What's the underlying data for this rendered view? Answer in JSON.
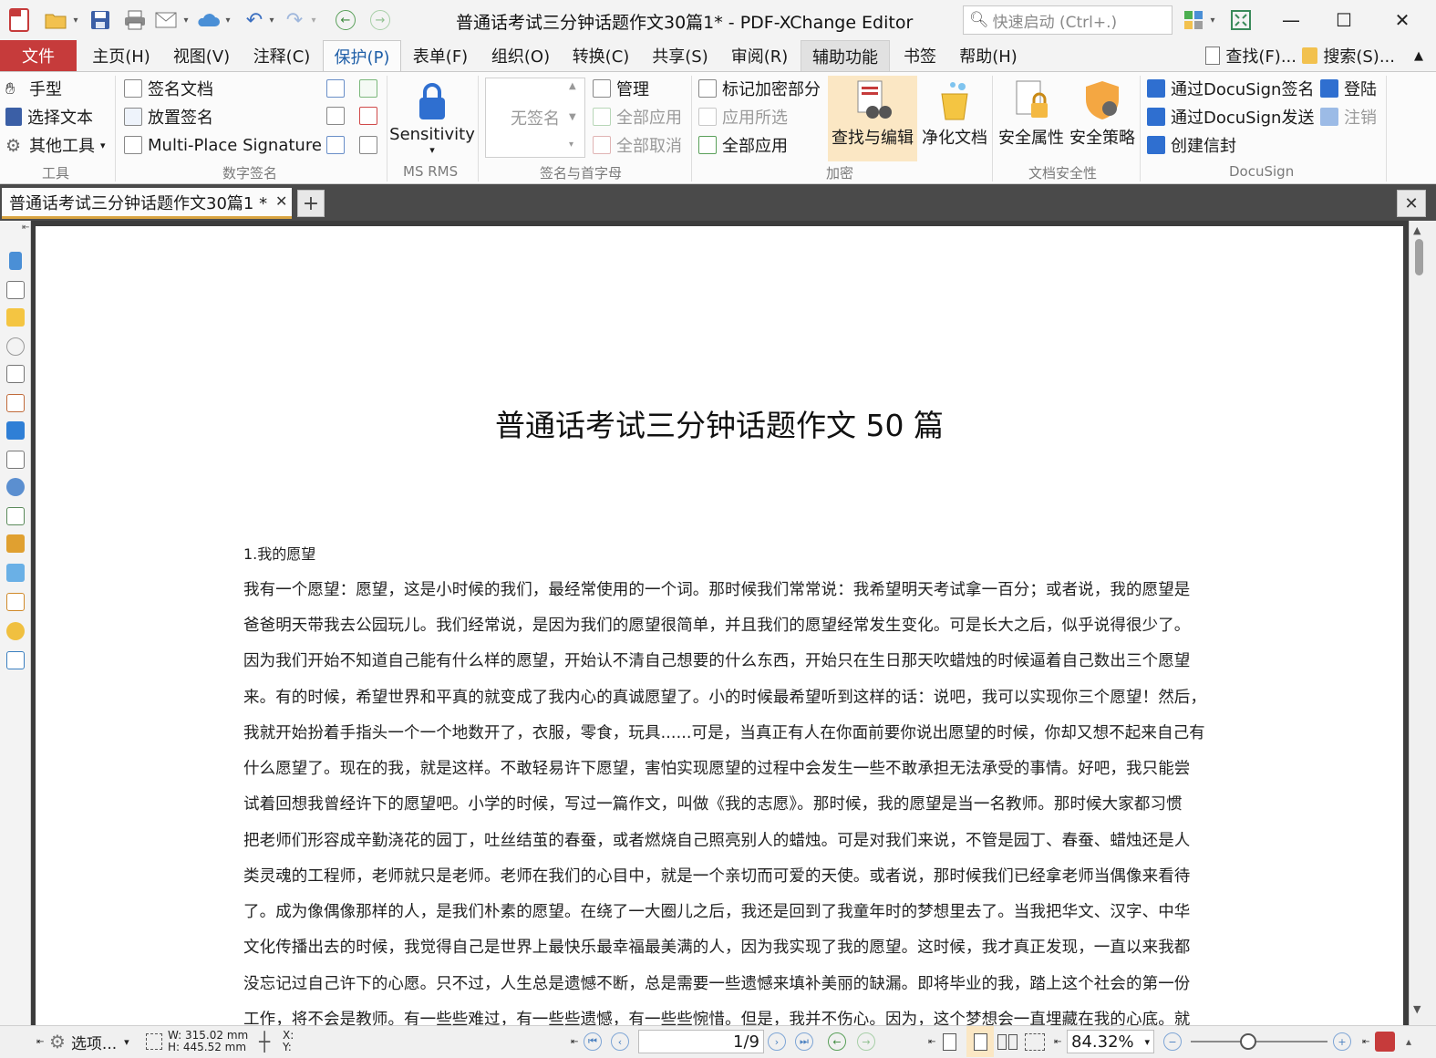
{
  "window": {
    "title": "普通话考试三分钟话题作文30篇1* - PDF-XChange Editor",
    "quick_launch_placeholder": "快速启动 (Ctrl+.)"
  },
  "menu": {
    "tabs": [
      "文件",
      "主页(H)",
      "视图(V)",
      "注释(C)",
      "保护(P)",
      "表单(F)",
      "组织(O)",
      "转换(C)",
      "共享(S)",
      "审阅(R)",
      "辅助功能",
      "书签",
      "帮助(H)"
    ],
    "active_tab": "保护(P)",
    "find_label": "查找(F)...",
    "search_label": "搜索(S)..."
  },
  "ribbon": {
    "tools": {
      "hand": "手型",
      "select_text": "选择文本",
      "other_tools": "其他工具",
      "group": "工具"
    },
    "digital_sign": {
      "sign_doc": "签名文档",
      "place_sig": "放置签名",
      "multi_place": "Multi-Place Signature",
      "group": "数字签名"
    },
    "ms_rms": {
      "sensitivity": "Sensitivity",
      "group": "MS RMS"
    },
    "sig_initials": {
      "no_signature": "无签名",
      "manage": "管理",
      "apply_all": "全部应用",
      "cancel_all": "全部取消",
      "group": "签名与首字母"
    },
    "redact": {
      "mark_redact": "标记加密部分",
      "apply_selected": "应用所选",
      "apply_all": "全部应用",
      "find_edit": "查找与编辑",
      "sanitize": "净化文档",
      "group": "加密"
    },
    "doc_security": {
      "sec_props": "安全属性",
      "sec_policy": "安全策略",
      "group": "文档安全性"
    },
    "docusign": {
      "sign_via": "通过DocuSign签名",
      "send_via": "通过DocuSign发送",
      "create_env": "创建信封",
      "login": "登陆",
      "logout": "注销",
      "group": "DocuSign"
    }
  },
  "doc_tab": {
    "name": "普通话考试三分钟话题作文30篇1 *"
  },
  "document": {
    "title": "普通话考试三分钟话题作文 50 篇",
    "section_heading": "1.我的愿望",
    "lines": [
      "我有一个愿望：愿望，这是小时候的我们，最经常使用的一个词。那时候我们常常说：我希望明天考试拿一百分；或者说，我的愿望是",
      "爸爸明天带我去公园玩儿。我们经常说，是因为我们的愿望很简单，并且我们的愿望经常发生变化。可是长大之后，似乎说得很少了。",
      "因为我们开始不知道自己能有什么样的愿望，开始认不清自己想要的什么东西，开始只在生日那天吹蜡烛的时候逼着自己数出三个愿望",
      "来。有的时候，希望世界和平真的就变成了我内心的真诚愿望了。小的时候最希望听到这样的话：说吧，我可以实现你三个愿望！然后，",
      "我就开始扮着手指头一个一个地数开了，衣服，零食，玩具......可是，当真正有人在你面前要你说出愿望的时候，你却又想不起来自己有",
      "什么愿望了。现在的我，就是这样。不敢轻易许下愿望，害怕实现愿望的过程中会发生一些不敢承担无法承受的事情。好吧，我只能尝",
      "试着回想我曾经许下的愿望吧。小学的时候，写过一篇作文，叫做《我的志愿》。那时候，我的愿望是当一名教师。那时候大家都习惯",
      "把老师们形容成辛勤浇花的园丁，吐丝结茧的春蚕，或者燃烧自己照亮别人的蜡烛。可是对我们来说，不管是园丁、春蚕、蜡烛还是人",
      "类灵魂的工程师，老师就只是老师。老师在我们的心目中，就是一个亲切而可爱的天使。或者说，那时候我们已经拿老师当偶像来看待",
      "了。成为像偶像那样的人，是我们朴素的愿望。在绕了一大圈儿之后，我还是回到了我童年时的梦想里去了。当我把华文、汉字、中华",
      "文化传播出去的时候，我觉得自己是世界上最快乐最幸福最美满的人，因为我实现了我的愿望。这时候，我才真正发现，一直以来我都",
      "没忘记过自己许下的心愿。只不过，人生总是遗憾不断，总是需要一些遗憾来填补美丽的缺漏。即将毕业的我，踏上这个社会的第一份",
      "工作，将不会是教师。有一些些难过，有一些些遗憾，有一些些惋惜。但是，我并不伤心。因为，这个梦想会一直埋藏在我的心底。就"
    ]
  },
  "status": {
    "options": "选项...",
    "width": "W: 315.02 mm",
    "height": "H: 445.52 mm",
    "x": "X:",
    "y": "Y:",
    "page": "1/9",
    "zoom": "84.32%"
  },
  "colors": {
    "file_tab": "#c63b3b",
    "active_tab_text": "#1f5fa8",
    "doc_tab_underline": "#d9a441",
    "workspace": "#3c3c3c"
  }
}
